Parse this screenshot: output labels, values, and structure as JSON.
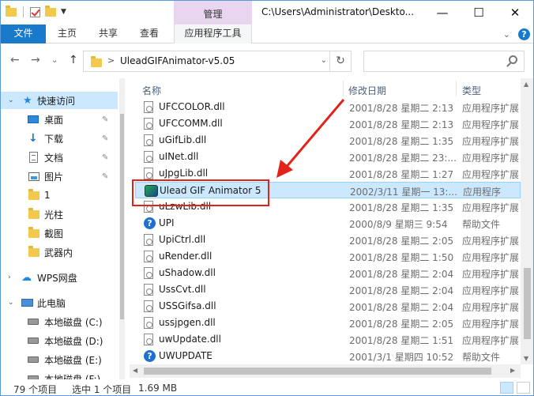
{
  "titlebar": {
    "context_tab": "管理",
    "path_title": "C:\\Users\\Administrator\\Deskto...",
    "minimize": "—",
    "maximize": "☐",
    "close": "✕"
  },
  "ribbon": {
    "tabs": [
      "文件",
      "主页",
      "共享",
      "查看",
      "应用程序工具"
    ],
    "expand": "⌄",
    "help": "?"
  },
  "address": {
    "back": "←",
    "forward": "→",
    "recent": "⌄",
    "up": "↑",
    "chevron": ">",
    "crumb": "UleadGIFAnimator-v5.05",
    "dropdown": "⌄",
    "refresh": "↻",
    "search_placeholder": ""
  },
  "nav": {
    "items": [
      {
        "label": "快速访问",
        "icon": "star-icon"
      },
      {
        "label": "桌面",
        "icon": "desktop-icon",
        "pin": "📌"
      },
      {
        "label": "下载",
        "icon": "download-icon",
        "pin": "📌"
      },
      {
        "label": "文档",
        "icon": "document-icon",
        "pin": "📌"
      },
      {
        "label": "图片",
        "icon": "picture-icon",
        "pin": "📌"
      },
      {
        "label": "1",
        "icon": "folder-icon"
      },
      {
        "label": "光柱",
        "icon": "folder-icon"
      },
      {
        "label": "截图",
        "icon": "folder-icon"
      },
      {
        "label": "武器内",
        "icon": "folder-icon"
      },
      {
        "label": "WPS网盘",
        "icon": "cloud-icon"
      },
      {
        "label": "此电脑",
        "icon": "computer-icon"
      },
      {
        "label": "本地磁盘 (C:)",
        "icon": "drive-icon"
      },
      {
        "label": "本地磁盘 (D:)",
        "icon": "drive-icon"
      },
      {
        "label": "本地磁盘 (E:)",
        "icon": "drive-icon"
      },
      {
        "label": "本地磁盘 (F:)",
        "icon": "drive-icon"
      }
    ]
  },
  "list": {
    "columns": {
      "name": "名称",
      "date": "修改日期",
      "type": "类型"
    },
    "rows": [
      {
        "name": "UFCCOLOR.dll",
        "date": "2001/8/28 星期二 2:13",
        "type": "应用程序扩展",
        "icon": "dll"
      },
      {
        "name": "UFCCOMM.dll",
        "date": "2001/8/28 星期二 2:13",
        "type": "应用程序扩展",
        "icon": "dll"
      },
      {
        "name": "uGifLib.dll",
        "date": "2001/8/28 星期二 1:35",
        "type": "应用程序扩展",
        "icon": "dll"
      },
      {
        "name": "uINet.dll",
        "date": "2001/8/28 星期二 23:...",
        "type": "应用程序扩展",
        "icon": "dll"
      },
      {
        "name": "uJpgLib.dll",
        "date": "2001/8/28 星期二 1:27",
        "type": "应用程序扩展",
        "icon": "dll"
      },
      {
        "name": "Ulead GIF Animator 5",
        "date": "2002/3/11 星期一 13:...",
        "type": "应用程序",
        "icon": "exe",
        "selected": true
      },
      {
        "name": "uLzwLib.dll",
        "date": "2001/8/28 星期二 1:35",
        "type": "应用程序扩展",
        "icon": "dll"
      },
      {
        "name": "UPI",
        "date": "2000/8/9 星期三 9:54",
        "type": "帮助文件",
        "icon": "help"
      },
      {
        "name": "UpiCtrl.dll",
        "date": "2001/8/28 星期二 2:05",
        "type": "应用程序扩展",
        "icon": "dll"
      },
      {
        "name": "uRender.dll",
        "date": "2001/8/28 星期二 1:50",
        "type": "应用程序扩展",
        "icon": "dll"
      },
      {
        "name": "uShadow.dll",
        "date": "2001/8/28 星期二 2:04",
        "type": "应用程序扩展",
        "icon": "dll"
      },
      {
        "name": "UssCvt.dll",
        "date": "2001/8/28 星期二 2:04",
        "type": "应用程序扩展",
        "icon": "dll"
      },
      {
        "name": "USSGifsa.dll",
        "date": "2001/8/28 星期二 2:04",
        "type": "应用程序扩展",
        "icon": "dll"
      },
      {
        "name": "ussjpgen.dll",
        "date": "2001/8/28 星期二 2:05",
        "type": "应用程序扩展",
        "icon": "dll"
      },
      {
        "name": "uwUpdate.dll",
        "date": "2001/8/28 星期二 1:51",
        "type": "应用程序扩展",
        "icon": "dll"
      },
      {
        "name": "UWUPDATE",
        "date": "2001/3/1 星期四 10:52",
        "type": "帮助文件",
        "icon": "help"
      }
    ]
  },
  "status": {
    "count": "79 个项目",
    "selection": "选中 1 个项目",
    "size": "1.69 MB"
  },
  "annotation_color": "#e2231a"
}
